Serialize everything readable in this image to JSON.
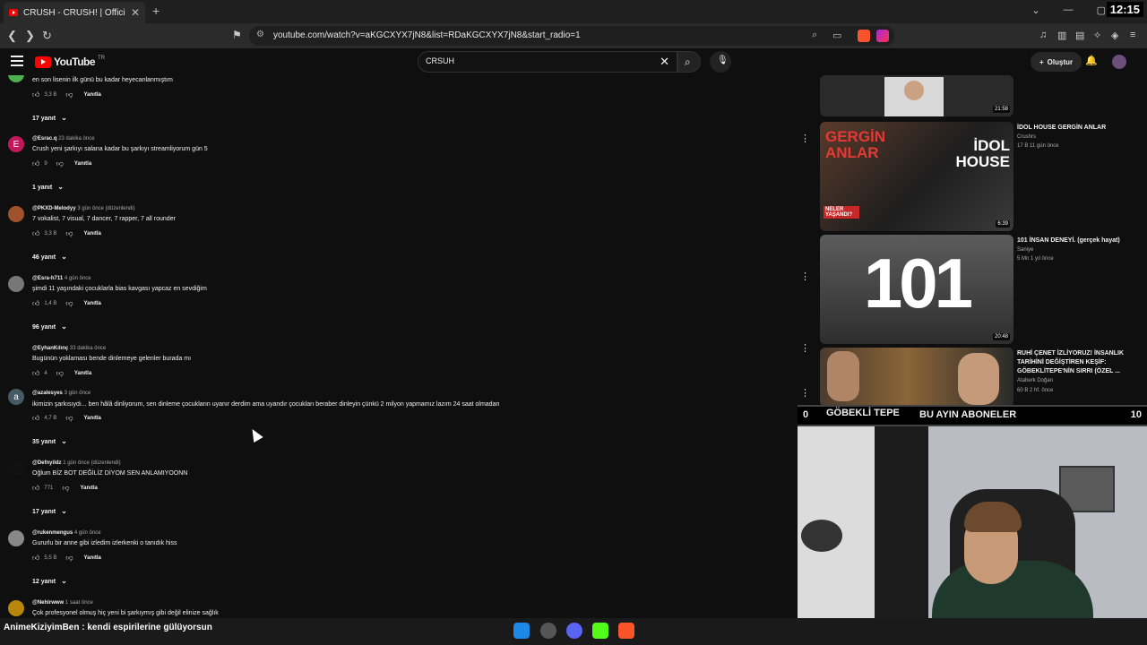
{
  "browser": {
    "tab_title": "CRUSH - CRUSH! | Official Music",
    "new_tab": "+",
    "clock": "12:15",
    "url": "youtube.com/watch?v=aKGCXYX7jN8&list=RDaKGCXYX7jN8&start_radio=1"
  },
  "youtube": {
    "logo_text": "YouTube",
    "logo_region": "TR",
    "search_value": "CRSUH",
    "create_label": "Oluştur"
  },
  "comments": [
    {
      "author": "",
      "time": "",
      "text": "en son lisenin ilk günü bu kadar heyecanlanmıştım",
      "likes": "3,3 B",
      "reply_label": "Yanıtla",
      "replies": "17 yanıt",
      "avatar_letter": "",
      "avatar_color": "#4caf50"
    },
    {
      "author": "@Esrac.q",
      "time": "23 dakika önce",
      "text": "Crush yeni şarkıyı salana kadar bu şarkıyı streamliyorum gün 5",
      "likes": "9",
      "reply_label": "Yanıtla",
      "replies": "1 yanıt",
      "avatar_letter": "E",
      "avatar_color": "#c2185b"
    },
    {
      "author": "@PKXD-Melodyy",
      "time": "3 gün önce (düzenlendi)",
      "text": "7 vokalist, 7 visual, 7 dancer, 7 rapper, 7 all rounder",
      "likes": "3,3 B",
      "reply_label": "Yanıtla",
      "replies": "46 yanıt",
      "avatar_letter": "",
      "avatar_color": "#a0522d"
    },
    {
      "author": "@Esra-h711",
      "time": "4 gün önce",
      "text": "şimdi 11 yaşındaki çocuklarla bias kavgası yapcaz en sevdiğim",
      "likes": "1,4 B",
      "reply_label": "Yanıtla",
      "replies": "96 yanıt",
      "avatar_letter": "",
      "avatar_color": "#777777"
    },
    {
      "author": "@EyhanKılınç",
      "time": "33 dakika önce",
      "text": "Bugünün yoklaması bende dinlemeye gelenler burada mı",
      "likes": "4",
      "reply_label": "Yanıtla",
      "replies": "",
      "avatar_letter": "",
      "avatar_color": "#0f0f0f"
    },
    {
      "author": "@azalesyes",
      "time": "3 gün önce",
      "text": "ikimizin şarkısıydı... ben hâlâ dinliyorum, sen dinleme çocukların uyanır derdim ama uyandır çocukları beraber dinleyin çünkü 2 milyon yapmamız lazım 24 saat olmadan",
      "likes": "4,7 B",
      "reply_label": "Yanıtla",
      "replies": "35 yanıt",
      "avatar_letter": "a",
      "avatar_color": "#455a64"
    },
    {
      "author": "@Defnyildz",
      "time": "1 gün önce (düzenlendi)",
      "text": "Oğlum BİZ BOT DEĞİLİZ DİYOM SEN ANLAMIYOONN",
      "likes": "771",
      "reply_label": "Yanıtla",
      "replies": "17 yanıt",
      "avatar_letter": "",
      "avatar_color": "#111111"
    },
    {
      "author": "@rukenmengus",
      "time": "4 gün önce",
      "text": "Gururlu bir anne gibi izledim izlerkenki o tanıdık hiss",
      "likes": "5,5 B",
      "reply_label": "Yanıtla",
      "replies": "12 yanıt",
      "avatar_letter": "",
      "avatar_color": "#888888"
    },
    {
      "author": "@Nehirwww",
      "time": "1 saat önce",
      "text": "Çok profesyonel olmuş hiç yeni bi şarkıymış gibi değil elinize sağlık",
      "likes": "",
      "reply_label": "",
      "replies": "",
      "avatar_letter": "",
      "avatar_color": "#b8860b"
    }
  ],
  "sidebar": {
    "videos": [
      {
        "title": "",
        "channel": "",
        "stats": "",
        "duration": "21:58",
        "thumb_color": "#2a2a2a"
      },
      {
        "title": "İDOL HOUSE GERGİN ANLAR",
        "channel": "Crushrs",
        "stats": "17 B  11 gün önce",
        "duration": "6:39",
        "thumb_color": "#3b3b3b",
        "thumb_text_1": "GERGİN ANLAR",
        "thumb_text_2": "İDOL HOUSE",
        "thumb_text_3": "NELER YAŞANDI?"
      },
      {
        "title": "101 İNSAN DENEYİ. (gerçek hayat)",
        "channel": "Saniye",
        "stats": "5 Mn  1 yıl önce",
        "duration": "20:48",
        "thumb_color": "#4a4a4a",
        "thumb_text_1": "101"
      },
      {
        "title": "RUHİ ÇENET İZLİYORUZ! İNSANLIK TARİHİNİ DEĞİŞTİREN KEŞİF: GÖBEKLİTEPE'NİN SIRRI (ÖZEL ...",
        "channel": "Ataberk Doğan",
        "stats": "60 B  2 hf. önce",
        "duration": "",
        "thumb_color": "#6b4a2a"
      }
    ]
  },
  "overlay": {
    "left_count": "0",
    "caption_partial": "GÖBEKLİ TEPE",
    "label": "BU AYIN ABONELER",
    "right_count": "10"
  },
  "taskbar": {
    "chat_message": "AnimeKiziyimBen : kendi espirilerine gülüyorsun"
  }
}
